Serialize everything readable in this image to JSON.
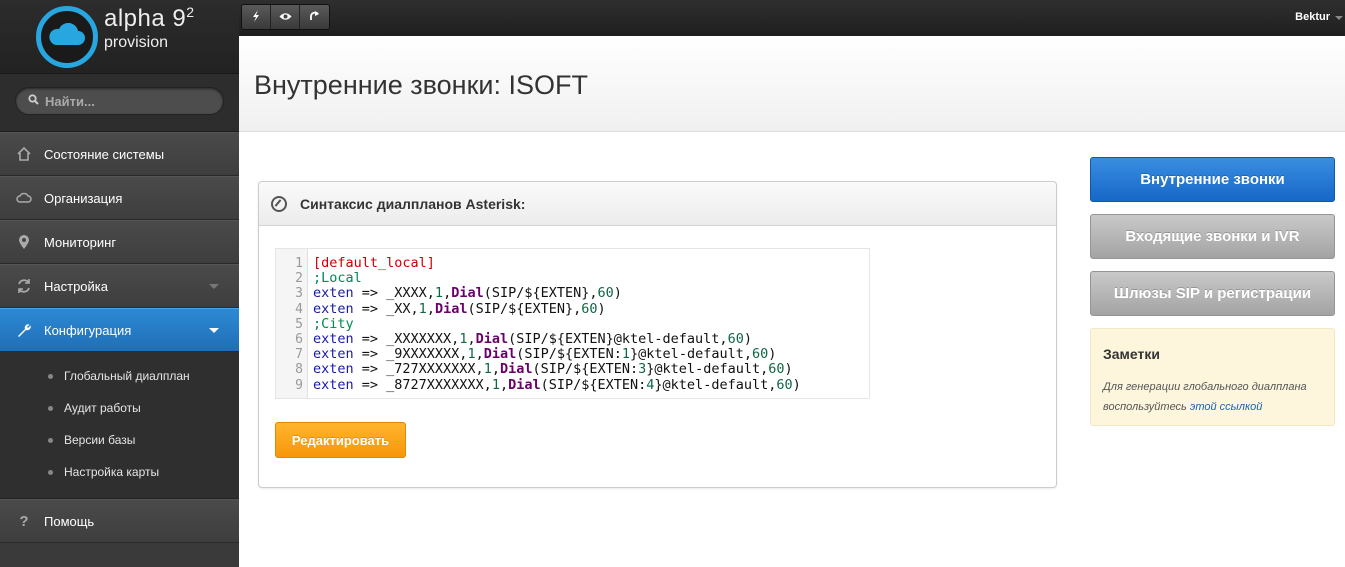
{
  "brand": {
    "line1": "alpha 9",
    "sup": "2",
    "line2": "provision"
  },
  "search": {
    "placeholder": "Найти..."
  },
  "sidebar": {
    "items": [
      {
        "label": "Состояние системы"
      },
      {
        "label": "Организация"
      },
      {
        "label": "Мониторинг"
      },
      {
        "label": "Настройка"
      },
      {
        "label": "Конфигурация"
      },
      {
        "label": "Помощь"
      }
    ],
    "subitems": [
      {
        "label": "Глобальный диалплан"
      },
      {
        "label": "Аудит работы"
      },
      {
        "label": "Версии базы"
      },
      {
        "label": "Настройка карты"
      }
    ]
  },
  "topbar": {
    "user": "Bektur"
  },
  "page": {
    "title": "Внутренние звонки: ISOFT"
  },
  "panel": {
    "title": "Синтаксис диалпланов Asterisk:",
    "line_numbers": [
      "1",
      "2",
      "3",
      "4",
      "5",
      "6",
      "7",
      "8",
      "9"
    ],
    "code": [
      [
        {
          "t": "[default_local]",
          "c": "section"
        }
      ],
      [
        {
          "t": ";Local",
          "c": "comment"
        }
      ],
      [
        {
          "t": "exten",
          "c": "kw"
        },
        {
          "t": " => _XXXX,",
          "c": ""
        },
        {
          "t": "1",
          "c": "num"
        },
        {
          "t": ",",
          "c": ""
        },
        {
          "t": "Dial",
          "c": "fn"
        },
        {
          "t": "(SIP/${EXTEN},",
          "c": ""
        },
        {
          "t": "60",
          "c": "num"
        },
        {
          "t": ")",
          "c": ""
        }
      ],
      [
        {
          "t": "exten",
          "c": "kw"
        },
        {
          "t": " => _XX,",
          "c": ""
        },
        {
          "t": "1",
          "c": "num"
        },
        {
          "t": ",",
          "c": ""
        },
        {
          "t": "Dial",
          "c": "fn"
        },
        {
          "t": "(SIP/${EXTEN},",
          "c": ""
        },
        {
          "t": "60",
          "c": "num"
        },
        {
          "t": ")",
          "c": ""
        }
      ],
      [
        {
          "t": ";City",
          "c": "comment"
        }
      ],
      [
        {
          "t": "exten",
          "c": "kw"
        },
        {
          "t": " => _XXXXXXX,",
          "c": ""
        },
        {
          "t": "1",
          "c": "num"
        },
        {
          "t": ",",
          "c": ""
        },
        {
          "t": "Dial",
          "c": "fn"
        },
        {
          "t": "(SIP/${EXTEN}@ktel-default,",
          "c": ""
        },
        {
          "t": "60",
          "c": "num"
        },
        {
          "t": ")",
          "c": ""
        }
      ],
      [
        {
          "t": "exten",
          "c": "kw"
        },
        {
          "t": " => _9XXXXXXX,",
          "c": ""
        },
        {
          "t": "1",
          "c": "num"
        },
        {
          "t": ",",
          "c": ""
        },
        {
          "t": "Dial",
          "c": "fn"
        },
        {
          "t": "(SIP/${EXTEN:",
          "c": ""
        },
        {
          "t": "1",
          "c": "num"
        },
        {
          "t": "}@ktel-default,",
          "c": ""
        },
        {
          "t": "60",
          "c": "num"
        },
        {
          "t": ")",
          "c": ""
        }
      ],
      [
        {
          "t": "exten",
          "c": "kw"
        },
        {
          "t": " => _727XXXXXXX,",
          "c": ""
        },
        {
          "t": "1",
          "c": "num"
        },
        {
          "t": ",",
          "c": ""
        },
        {
          "t": "Dial",
          "c": "fn"
        },
        {
          "t": "(SIP/${EXTEN:",
          "c": ""
        },
        {
          "t": "3",
          "c": "num"
        },
        {
          "t": "}@ktel-default,",
          "c": ""
        },
        {
          "t": "60",
          "c": "num"
        },
        {
          "t": ")",
          "c": ""
        }
      ],
      [
        {
          "t": "exten",
          "c": "kw"
        },
        {
          "t": " => _8727XXXXXXX,",
          "c": ""
        },
        {
          "t": "1",
          "c": "num"
        },
        {
          "t": ",",
          "c": ""
        },
        {
          "t": "Dial",
          "c": "fn"
        },
        {
          "t": "(SIP/${EXTEN:",
          "c": ""
        },
        {
          "t": "4",
          "c": "num"
        },
        {
          "t": "}@ktel-default,",
          "c": ""
        },
        {
          "t": "60",
          "c": "num"
        },
        {
          "t": ")",
          "c": ""
        }
      ]
    ],
    "edit_label": "Редактировать"
  },
  "right": {
    "btn_internal": "Внутренние звонки",
    "btn_incoming": "Входящие звонки и IVR",
    "btn_gateways": "Шлюзы SIP и регистрации"
  },
  "notes": {
    "title": "Заметки",
    "text": "Для генерации глобального диалплана воспользуйтесь",
    "link": "этой ссылкой"
  },
  "colors": {
    "accent_blue": "#1f6fb6",
    "edit_orange": "#f7960a",
    "brand_cyan": "#27a6e0"
  }
}
